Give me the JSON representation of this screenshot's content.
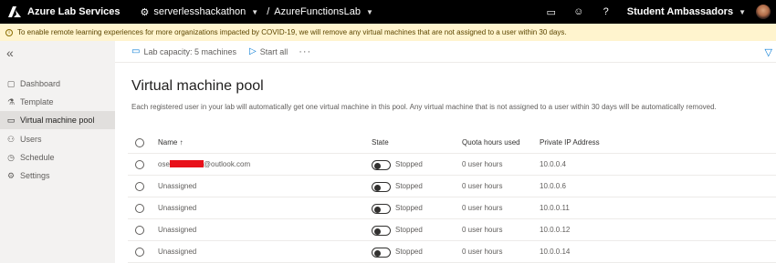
{
  "topbar": {
    "app_title": "Azure Lab Services",
    "account": "serverlesshackathon",
    "separator": "/",
    "lab": "AzureFunctionsLab",
    "user": "Student Ambassadors"
  },
  "banner": {
    "text": "To enable remote learning experiences for more organizations impacted by COVID-19, we will remove any virtual machines that are not assigned to a user within 30 days."
  },
  "sidebar": {
    "items": [
      {
        "label": "Dashboard",
        "icon": "dashboard-icon"
      },
      {
        "label": "Template",
        "icon": "template-icon"
      },
      {
        "label": "Virtual machine pool",
        "icon": "monitor-icon",
        "active": true
      },
      {
        "label": "Users",
        "icon": "users-icon"
      },
      {
        "label": "Schedule",
        "icon": "schedule-icon"
      },
      {
        "label": "Settings",
        "icon": "settings-icon"
      }
    ]
  },
  "commandbar": {
    "lab_capacity": "Lab capacity: 5 machines",
    "start_all": "Start all",
    "more": "···"
  },
  "main": {
    "title": "Virtual machine pool",
    "description": "Each registered user in your lab will automatically get one virtual machine in this pool. Any virtual machine that is not assigned to a user within 30 days will be automatically removed."
  },
  "table": {
    "columns": {
      "name": "Name ↑",
      "state": "State",
      "quota": "Quota hours used",
      "ip": "Private IP Address"
    },
    "rows": [
      {
        "name_prefix": "ose",
        "name_suffix": "@outlook.com",
        "redacted": true,
        "state": "Stopped",
        "quota": "0 user hours",
        "ip": "10.0.0.4"
      },
      {
        "name": "Unassigned",
        "state": "Stopped",
        "quota": "0 user hours",
        "ip": "10.0.0.6"
      },
      {
        "name": "Unassigned",
        "state": "Stopped",
        "quota": "0 user hours",
        "ip": "10.0.0.11"
      },
      {
        "name": "Unassigned",
        "state": "Stopped",
        "quota": "0 user hours",
        "ip": "10.0.0.12"
      },
      {
        "name": "Unassigned",
        "state": "Stopped",
        "quota": "0 user hours",
        "ip": "10.0.0.14"
      }
    ]
  },
  "colors": {
    "topbar": "#000000",
    "banner": "#fff4ce",
    "sidebar": "#f3f2f1",
    "accent": "#0078d4",
    "redaction": "#e8111a"
  }
}
